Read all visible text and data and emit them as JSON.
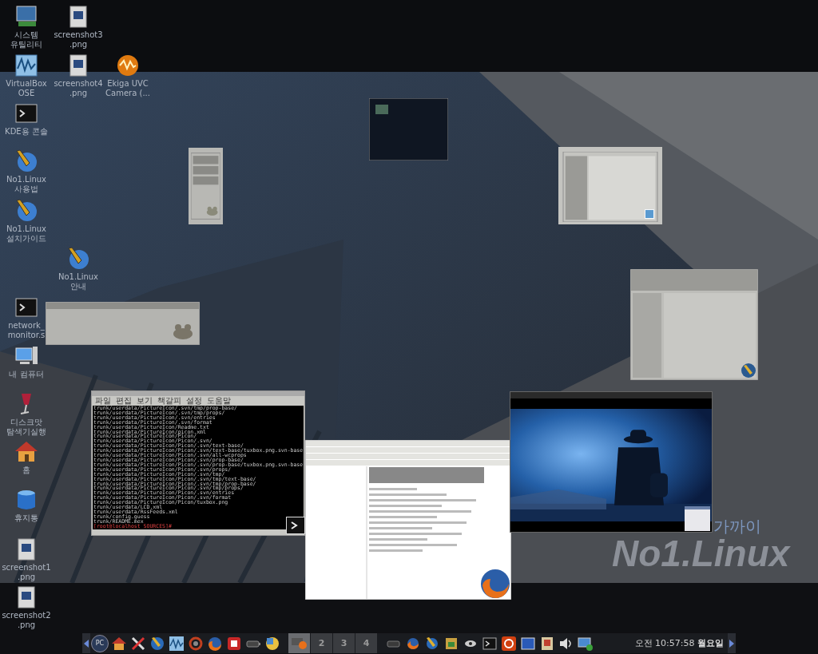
{
  "desktop_icons": [
    {
      "label": "시스템\n유틸리티"
    },
    {
      "label": "screenshot3\n.png"
    },
    {
      "label": "VirtualBox\nOSE"
    },
    {
      "label": "screenshot4\n.png"
    },
    {
      "label": "Ekiga UVC\nCamera (..."
    },
    {
      "label": "KDE용 콘솔"
    },
    {
      "label": "No1.Linux\n사용법"
    },
    {
      "label": "No1.Linux\n설치가이드"
    },
    {
      "label": "No1.Linux\n안내"
    },
    {
      "label": "network_\nmonitor.s"
    },
    {
      "label": "내 컴퓨터"
    },
    {
      "label": "디스크맛\n탐색기실행"
    },
    {
      "label": "홈"
    },
    {
      "label": "휴지통"
    },
    {
      "label": "screenshot1\n.png"
    },
    {
      "label": "screenshot2\n.png"
    }
  ],
  "wallpaper": {
    "slogan": "가까이",
    "brand": "No1.Linux"
  },
  "terminal": {
    "menu": [
      "파일",
      "편집",
      "보기",
      "책갈피",
      "설정",
      "도움말"
    ],
    "lines": [
      "trunk/userdata/PictureIcon/.svn/tmp/prop-base/",
      "trunk/userdata/PictureIcon/.svn/tmp/props/",
      "trunk/userdata/PictureIcon/.svn/entries",
      "trunk/userdata/PictureIcon/.svn/format",
      "trunk/userdata/PictureIcon/Readme.txt",
      "trunk/userdata/PictureIcon/picon.xml",
      "trunk/userdata/PictureIcon/Picon/",
      "trunk/userdata/PictureIcon/Picon/.svn/",
      "trunk/userdata/PictureIcon/Picon/.svn/text-base/",
      "trunk/userdata/PictureIcon/Picon/.svn/text-base/tuxbox.png.svn-base",
      "trunk/userdata/PictureIcon/Picon/.svn/all-wcprops",
      "trunk/userdata/PictureIcon/Picon/.svn/prop-base/",
      "trunk/userdata/PictureIcon/Picon/.svn/prop-base/tuxbox.png.svn-base",
      "trunk/userdata/PictureIcon/Picon/.svn/props/",
      "trunk/userdata/PictureIcon/Picon/.svn/tmp/",
      "trunk/userdata/PictureIcon/Picon/.svn/tmp/text-base/",
      "trunk/userdata/PictureIcon/Picon/.svn/tmp/prop-base/",
      "trunk/userdata/PictureIcon/Picon/.svn/tmp/props/",
      "trunk/userdata/PictureIcon/Picon/.svn/entries",
      "trunk/userdata/PictureIcon/Picon/.svn/format",
      "trunk/userdata/PictureIcon/Picon/tuxbox.png",
      "trunk/userdata/LCD.xml",
      "trunk/userdata/RssFeeds.xml",
      "trunk/config.guess",
      "trunk/README.mex"
    ],
    "prompt": "[root@localhost SOURCES]#"
  },
  "taskbar": {
    "start_label": "PC",
    "pager": [
      {
        "selected": true
      },
      {
        "label": "2",
        "selected": false
      },
      {
        "label": "3",
        "selected": false
      },
      {
        "label": "4",
        "selected": false
      }
    ],
    "clock": "오전 10:57:58 **월요일**"
  }
}
